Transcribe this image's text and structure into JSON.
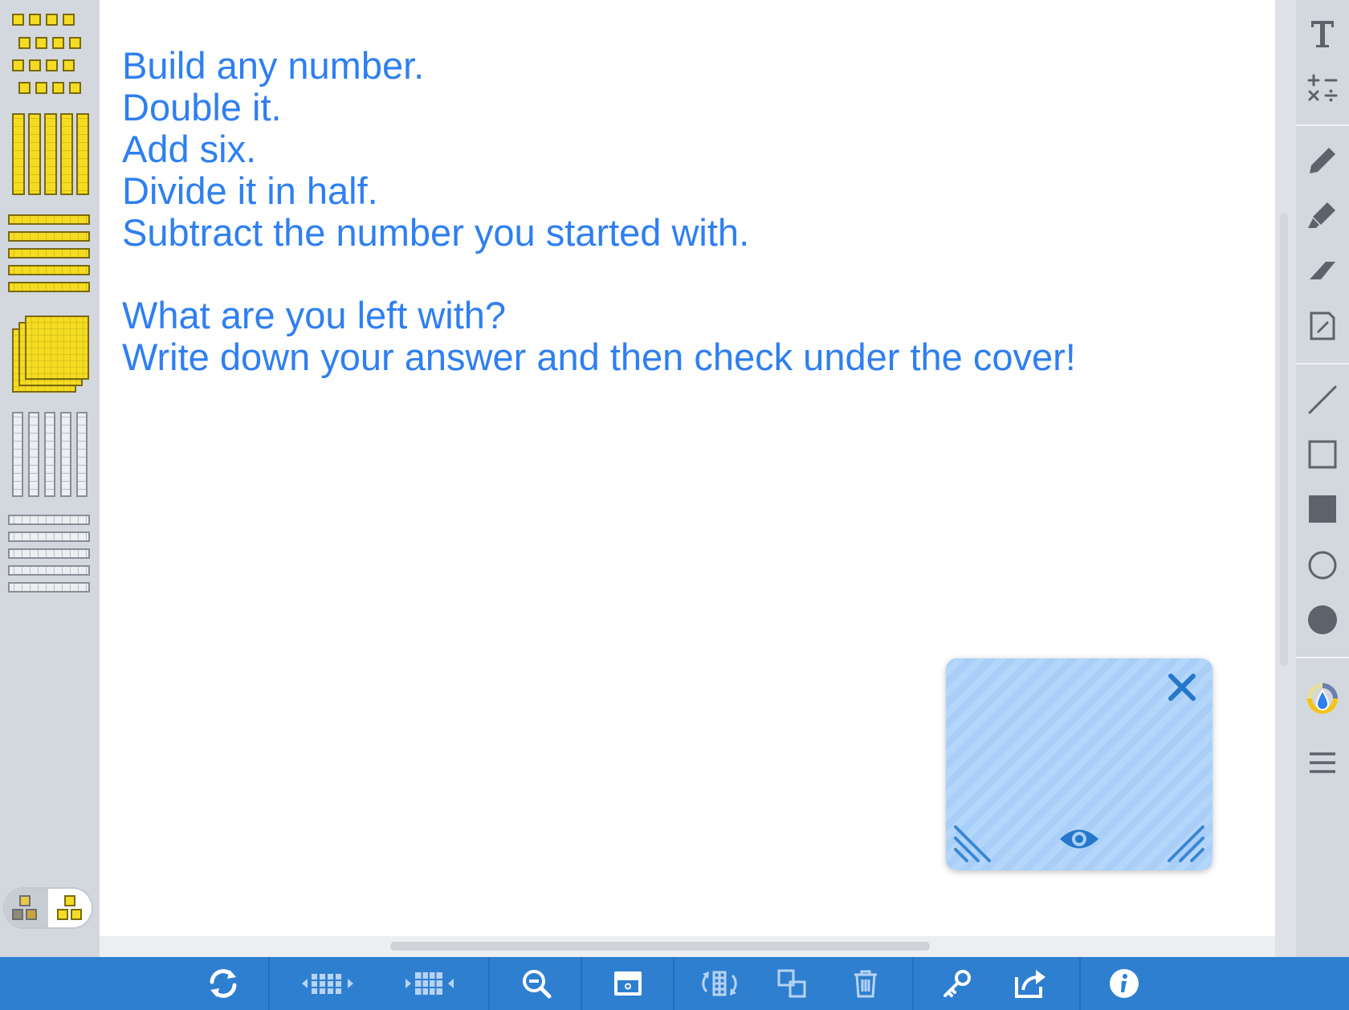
{
  "canvas": {
    "prompt_lines": [
      "Build any number.",
      "Double it.",
      "Add six.",
      "Divide it in half.",
      "Subtract the number you started with."
    ],
    "question_lines": [
      "What are you left with?",
      "Write down your answer and then check under the cover!"
    ]
  },
  "left_palette": {
    "items": [
      {
        "icon": "unit-cubes-yellow-icon"
      },
      {
        "icon": "ten-rods-vertical-yellow-icon"
      },
      {
        "icon": "ten-rods-horizontal-yellow-icon"
      },
      {
        "icon": "hundred-flats-yellow-icon"
      },
      {
        "icon": "ten-rods-vertical-outline-icon"
      },
      {
        "icon": "ten-rods-horizontal-outline-icon"
      }
    ],
    "toggle": {
      "off_icon": "blocks-grey-icon",
      "on_icon": "blocks-yellow-icon"
    }
  },
  "right_toolbar": {
    "tools": [
      "text-icon",
      "math-symbols-icon",
      "pencil-icon",
      "highlighter-icon",
      "eraser-icon",
      "note-icon",
      "line-icon",
      "rectangle-outline-icon",
      "rectangle-filled-icon",
      "circle-outline-icon",
      "circle-filled-icon",
      "color-picker-icon",
      "menu-icon"
    ]
  },
  "bottom_toolbar": {
    "tools": [
      "reset-icon",
      "shrink-grid-icon",
      "expand-grid-icon",
      "zoom-out-icon",
      "cover-icon",
      "regroup-icon",
      "duplicate-icon",
      "trash-icon",
      "key-icon",
      "share-icon",
      "info-icon"
    ]
  },
  "colors": {
    "text": "#2f7ff0",
    "toolbar": "#2e7fd0",
    "block_yellow": "#f5dc22",
    "cover": "#a9cff8",
    "cover_icon": "#2577cc"
  }
}
